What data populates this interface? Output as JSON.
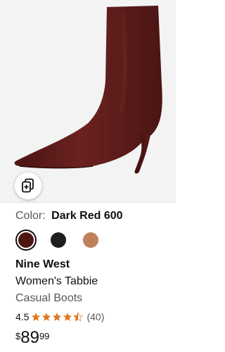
{
  "product": {
    "color_label": "Color:",
    "color_value": "Dark Red 600",
    "swatches": [
      {
        "name": "Dark Red 600",
        "color": "#4e1613",
        "selected": true
      },
      {
        "name": "Black",
        "color": "#1e1e1e",
        "selected": false
      },
      {
        "name": "Tan",
        "color": "#c0805e",
        "selected": false
      }
    ],
    "brand": "Nine West",
    "title_line1": "Women's Tabbie",
    "title_line2": "Casual Boots",
    "rating": "4.5",
    "rating_count": "(40)",
    "price": {
      "symbol": "$",
      "whole": "89",
      "fraction": "99"
    }
  },
  "icons": {
    "compare": "compare-icon",
    "star": "star-icon"
  },
  "colors": {
    "boot": "#5a1a18",
    "star": "#de7921",
    "accent_text": "#0F1111"
  }
}
